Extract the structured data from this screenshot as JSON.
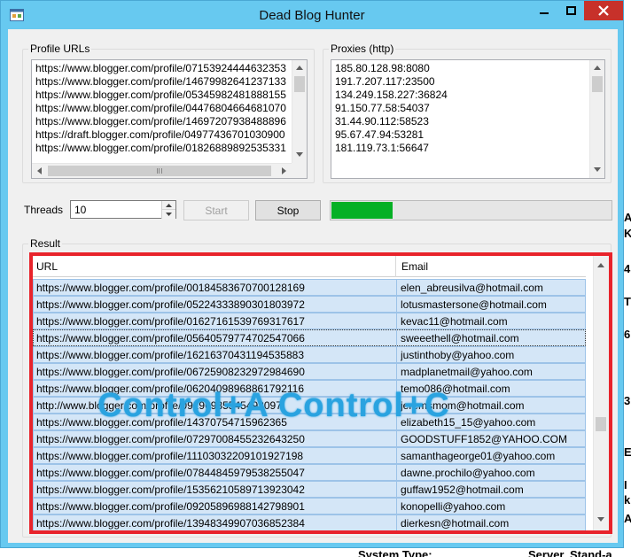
{
  "window": {
    "title": "Dead Blog Hunter",
    "icon": "app-window-icon",
    "accent": "#67c9f0",
    "close_color": "#c7312a"
  },
  "profile_urls": {
    "label": "Profile URLs",
    "lines": [
      "https://www.blogger.com/profile/07153924444632353",
      "https://www.blogger.com/profile/14679982641237133",
      "https://www.blogger.com/profile/05345982481888155",
      "https://www.blogger.com/profile/04476804664681070",
      "https://www.blogger.com/profile/14697207938488896",
      "https://draft.blogger.com/profile/04977436701030900",
      "https://www.blogger.com/profile/01826889892535331"
    ]
  },
  "proxies": {
    "label": "Proxies (http)",
    "lines": [
      "185.80.128.98:8080",
      "191.7.207.117:23500",
      "134.249.158.227:36824",
      "91.150.77.58:54037",
      "31.44.90.112:58523",
      "95.67.47.94:53281",
      "181.119.73.1:56647"
    ]
  },
  "controls": {
    "threads_label": "Threads",
    "threads_value": "10",
    "start_label": "Start",
    "stop_label": "Stop",
    "progress_fraction": 0.22,
    "progress_color": "#06b025"
  },
  "result": {
    "label": "Result",
    "columns": [
      "URL",
      "Email"
    ],
    "rows": [
      {
        "url": "https://www.blogger.com/profile/00184583670700128169",
        "email": "elen_abreusilva@hotmail.com"
      },
      {
        "url": "https://www.blogger.com/profile/05224333890301803972",
        "email": "lotusmastersone@hotmail.com"
      },
      {
        "url": "https://www.blogger.com/profile/01627161539769317617",
        "email": "kevac11@hotmail.com"
      },
      {
        "url": "https://www.blogger.com/profile/05640579774702547066",
        "email": "sweeethell@hotmail.com"
      },
      {
        "url": "https://www.blogger.com/profile/16216370431194535883",
        "email": "justinthoby@yahoo.com"
      },
      {
        "url": "https://www.blogger.com/profile/06725908232972984690",
        "email": "madplanetmail@yahoo.com"
      },
      {
        "url": "https://www.blogger.com/profile/06204098968861792116",
        "email": "temo086@hotmail.com"
      },
      {
        "url": "http://www.blogger.com/profile/09296935545492097",
        "email": "jeremsmom@hotmail.com"
      },
      {
        "url": "https://www.blogger.com/profile/14370754715962365",
        "email": "elizabeth15_15@yahoo.com"
      },
      {
        "url": "https://www.blogger.com/profile/07297008455232643250",
        "email": "GOODSTUFF1852@YAHOO.COM"
      },
      {
        "url": "https://www.blogger.com/profile/11103032209101927198",
        "email": "samanthageorge01@yahoo.com"
      },
      {
        "url": "https://www.blogger.com/profile/07844845979538255047",
        "email": "dawne.prochilo@yahoo.com"
      },
      {
        "url": "https://www.blogger.com/profile/15356210589713923042",
        "email": "guffaw1952@hotmail.com"
      },
      {
        "url": "https://www.blogger.com/profile/09205896988142798901",
        "email": "konopelli@yahoo.com"
      },
      {
        "url": "https://www.blogger.com/profile/13948349907036852384",
        "email": "dierkesn@hotmail.com"
      }
    ],
    "highlight_color": "#e8232b"
  },
  "overlay_text": "Control+A  Control+C",
  "background": {
    "letters": [
      "A",
      "K",
      "4",
      "T",
      "6",
      "3",
      "E",
      "I",
      "k",
      "A"
    ],
    "footer_left": "System Type:",
    "footer_right": "Server, Stand-a"
  }
}
